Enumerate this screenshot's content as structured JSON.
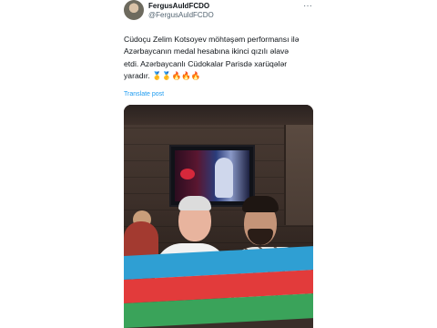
{
  "tweet": {
    "display_name": "FergusAuldFCDO",
    "handle": "@FergusAuldFCDO",
    "text_lines": [
      "Cüdoçu Zelim Kotsoyev möhtəşəm performansı ilə",
      "Azərbaycanın medal hesabına ikinci qızılı əlavə",
      "etdi. Azərbaycanlı Cüdokalar Parisdə xarüqələr",
      "yaradır. 🥇🥇🔥🔥🔥"
    ],
    "translate_label": "Translate post"
  },
  "icons": {
    "more": "more-horizontal-icon",
    "avatar": "profile-avatar"
  },
  "colors": {
    "link": "#1d9bf0",
    "text": "#0f1419",
    "secondary": "#536471",
    "flag_blue": "#2f9fd3",
    "flag_red": "#e23b3b",
    "flag_green": "#3aa35a"
  }
}
